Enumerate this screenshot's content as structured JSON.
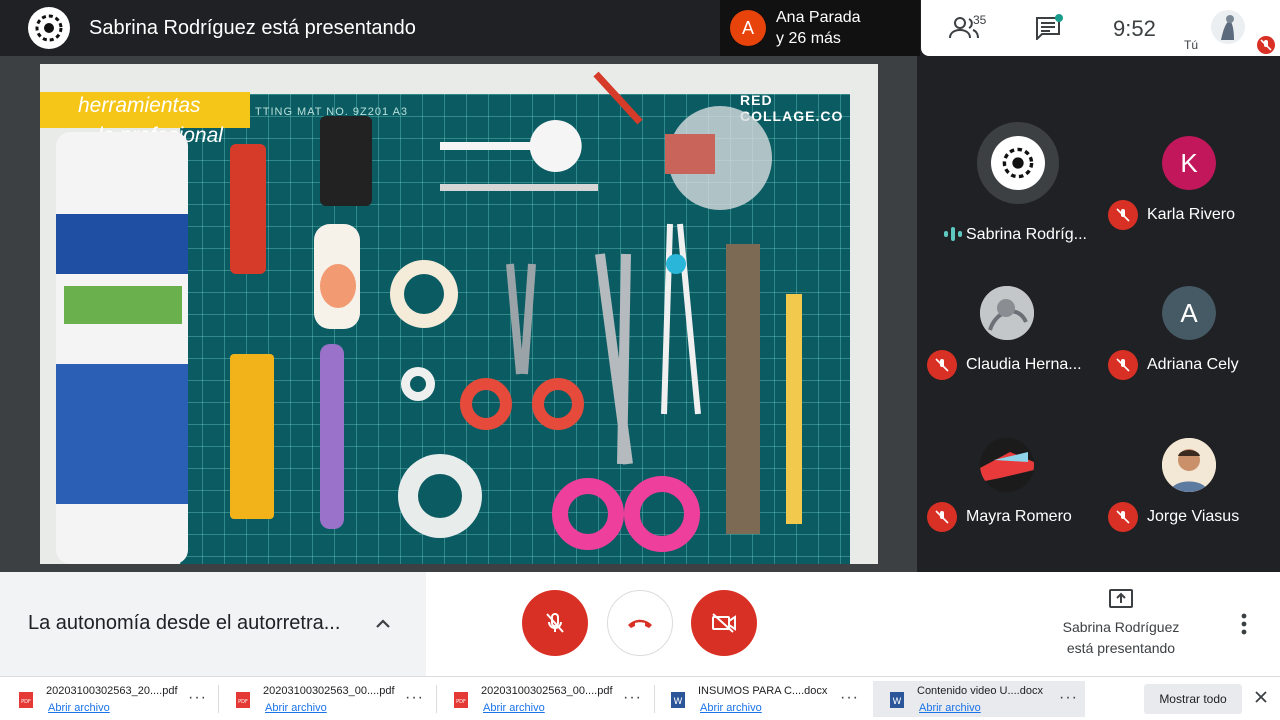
{
  "topbar": {
    "presenter_title": "Sabrina Rodríguez está presentando",
    "notification": {
      "initial": "A",
      "line1": "Ana Parada",
      "line2": "y 26 más"
    },
    "participants_count": "35",
    "clock": "9:52",
    "self_label": "Tú"
  },
  "shared_image": {
    "banner_line1": "herramientas",
    "banner_line2": "lo profesional",
    "brand": "RED COLLAGE.CO",
    "mat_text": "TTING MAT   NO. 9Z201   A3"
  },
  "participants": [
    {
      "name": "Sabrina Rodríg...",
      "status": "speaking",
      "avatar": "logo"
    },
    {
      "name": "Karla Rivero",
      "status": "muted",
      "avatar_initial": "K",
      "avatar_color": "#c2185b"
    },
    {
      "name": "Claudia Herna...",
      "status": "muted",
      "avatar": "photo"
    },
    {
      "name": "Adriana Cely",
      "status": "muted",
      "avatar_initial": "A",
      "avatar_color": "#455a64"
    },
    {
      "name": "Mayra Romero",
      "status": "muted",
      "avatar": "photo"
    },
    {
      "name": "Jorge Viasus",
      "status": "muted",
      "avatar": "photo"
    }
  ],
  "controls": {
    "meeting_name": "La autonomía desde el autorretra...",
    "presenting_line1": "Sabrina Rodríguez",
    "presenting_line2": "está presentando"
  },
  "downloads": {
    "items": [
      {
        "name": "20203100302563_20....pdf",
        "action": "Abrir archivo",
        "type": "pdf"
      },
      {
        "name": "20203100302563_00....pdf",
        "action": "Abrir archivo",
        "type": "pdf"
      },
      {
        "name": "20203100302563_00....pdf",
        "action": "Abrir archivo",
        "type": "pdf"
      },
      {
        "name": "INSUMOS PARA C....docx",
        "action": "Abrir archivo",
        "type": "docx"
      },
      {
        "name": "Contenido video U....docx",
        "action": "Abrir archivo",
        "type": "docx"
      }
    ],
    "show_all": "Mostrar todo"
  },
  "colors": {
    "danger": "#d93025",
    "dark_bg": "#202124",
    "link": "#1a73e8",
    "accent": "#1a9c8c"
  }
}
